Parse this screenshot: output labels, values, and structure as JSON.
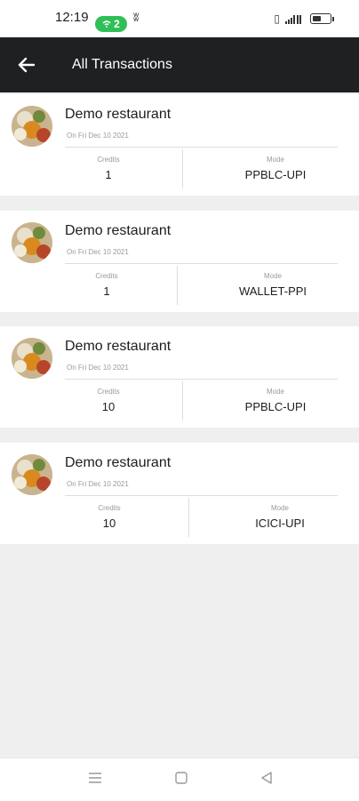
{
  "status_bar": {
    "time": "12:19",
    "pill_count": "2",
    "icons": [
      "wifi-icon",
      "app-icon",
      "vibrate-icon",
      "signal-icon",
      "battery-icon"
    ]
  },
  "app_bar": {
    "title": "All Transactions",
    "back_icon": "arrow-left-icon",
    "background": "#1f2022"
  },
  "transactions": [
    {
      "name": "Demo restaurant",
      "date": "On Fri Dec 10 2021",
      "credits_label": "Credits",
      "credits": "1",
      "mode_label": "Mode",
      "mode": "PPBLC-UPI"
    },
    {
      "name": "Demo restaurant",
      "date": "On Fri Dec 10 2021",
      "credits_label": "Credits",
      "credits": "1",
      "mode_label": "Mode",
      "mode": "WALLET-PPI"
    },
    {
      "name": "Demo restaurant",
      "date": "On Fri Dec 10 2021",
      "credits_label": "Credits",
      "credits": "10",
      "mode_label": "Mode",
      "mode": "PPBLC-UPI"
    },
    {
      "name": "Demo restaurant",
      "date": "On Fri Dec 10 2021",
      "credits_label": "Credits",
      "credits": "10",
      "mode_label": "Mode",
      "mode": "ICICI-UPI"
    }
  ],
  "nav_bar": {
    "icons": [
      "menu-icon",
      "home-icon",
      "back-icon"
    ]
  },
  "colors": {
    "accent_green": "#2fbf57",
    "app_bar": "#1f2022",
    "page_bg": "#efefef"
  }
}
